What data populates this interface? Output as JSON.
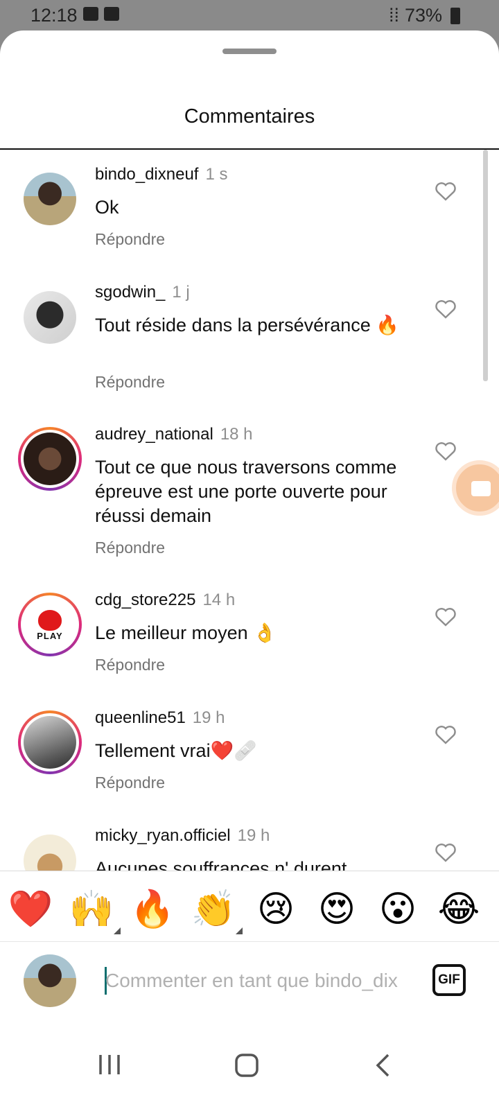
{
  "status_bar": {
    "time": "12:18",
    "battery": "73%"
  },
  "sheet": {
    "title": "Commentaires"
  },
  "comments": [
    {
      "username": "bindo_dixneuf",
      "time": "1 s",
      "text": "Ok",
      "reply_label": "Répondre"
    },
    {
      "username": "sgodwin_",
      "time": "1 j",
      "text": "Tout réside dans la persévérance 🔥",
      "reply_label": "Répondre"
    },
    {
      "username": "audrey_national",
      "time": "18 h",
      "text": "Tout ce que nous traversons comme épreuve est une porte ouverte pour réussi demain",
      "reply_label": "Répondre"
    },
    {
      "username": "cdg_store225",
      "time": "14 h",
      "text": "Le meilleur moyen 👌",
      "reply_label": "Répondre",
      "avatar_text": "PLAY"
    },
    {
      "username": "queenline51",
      "time": "19 h",
      "text": "Tellement vrai❤️🩹",
      "reply_label": "Répondre"
    },
    {
      "username": "micky_ryan.officiel",
      "time": "19 h",
      "text": "Aucunes souffrances n' durent"
    }
  ],
  "quick_reactions": [
    "❤️",
    "🙌",
    "🔥",
    "👏",
    "😢",
    "😍",
    "😮",
    "😂"
  ],
  "composer": {
    "placeholder": "Commenter en tant que bindo_dix",
    "gif_label": "GIF"
  },
  "colors": {
    "story_ring": "#dd2a7b",
    "heart_red": "#e0191b",
    "cursor": "#0a6e6e"
  },
  "icons": [
    "heart-outline-icon",
    "gif-icon",
    "recent-apps-icon",
    "home-icon",
    "back-icon",
    "camera-icon"
  ]
}
